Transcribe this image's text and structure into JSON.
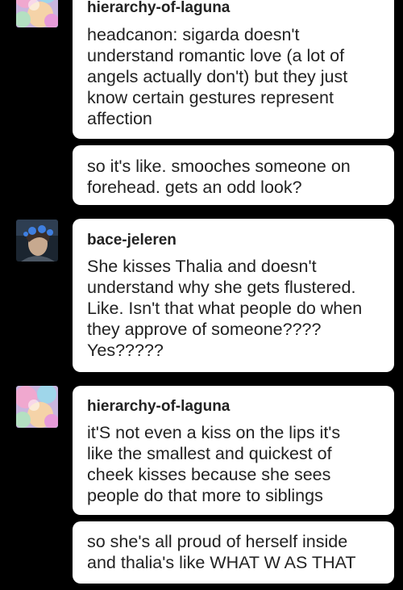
{
  "messages": [
    {
      "username": "hierarchy-of-laguna",
      "text": "headcanon: sigarda doesn't\nunderstand romantic love (a lot of\nangels actually don't) but they just\nknow certain gestures represent\naffection"
    },
    {
      "text": "so it's like. smooches someone on\nforehead. gets an odd look?"
    },
    {
      "username": "bace-jeleren",
      "text": "She kisses Thalia and doesn't\nunderstand why she gets flustered.\nLike. Isn't that what people do when\nthey approve of someone????\nYes?????"
    },
    {
      "username": "hierarchy-of-laguna",
      "text": "it'S not even a kiss on the lips it's\nlike the smallest and quickest of\ncheek kisses because she sees\npeople do that more to siblings"
    },
    {
      "text": "so she's all proud of herself inside\nand thalia's like WHAT W AS THAT"
    }
  ],
  "colors": {
    "background": "#000000",
    "bubble": "#ffffff",
    "text": "#222222"
  },
  "icons": {
    "laguna_avatar": "pastel-watercolor-avatar-icon",
    "bace_avatar": "character-portrait-avatar-icon"
  }
}
